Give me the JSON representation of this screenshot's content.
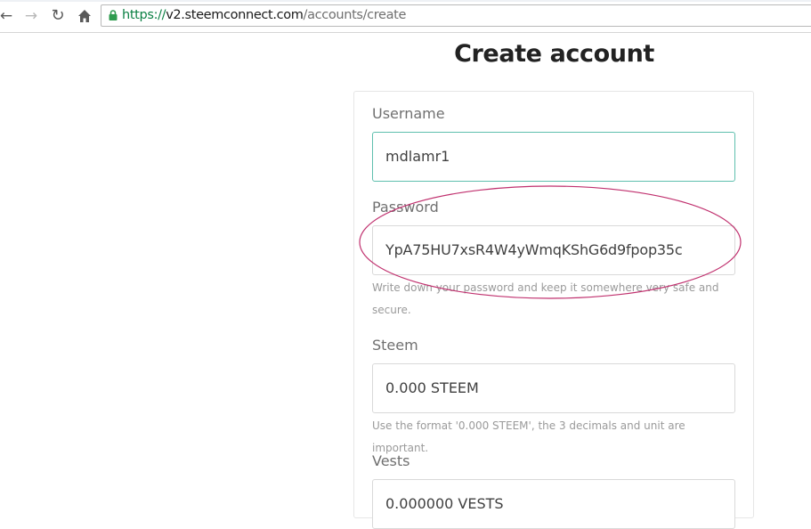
{
  "browser": {
    "url_scheme": "https://",
    "url_host": "v2.steemconnect.com",
    "url_path": "/accounts/create"
  },
  "page": {
    "title": "Create account"
  },
  "form": {
    "username": {
      "label": "Username",
      "value": "mdlamr1"
    },
    "password": {
      "label": "Password",
      "value": "YpA75HU7xsR4W4yWmqKShG6d9fpop35c",
      "help": "Write down your password and keep it somewhere very safe and secure."
    },
    "steem": {
      "label": "Steem",
      "value": "0.000 STEEM",
      "help": "Use the format '0.000 STEEM', the 3 decimals and unit are important."
    },
    "vests": {
      "label": "Vests",
      "value": "0.000000 VESTS"
    }
  },
  "annotation": {
    "color": "#c0306e"
  },
  "icons": {
    "back": "arrow-left-icon",
    "forward": "arrow-right-icon",
    "reload": "reload-icon",
    "home": "home-icon",
    "lock": "lock-icon"
  }
}
